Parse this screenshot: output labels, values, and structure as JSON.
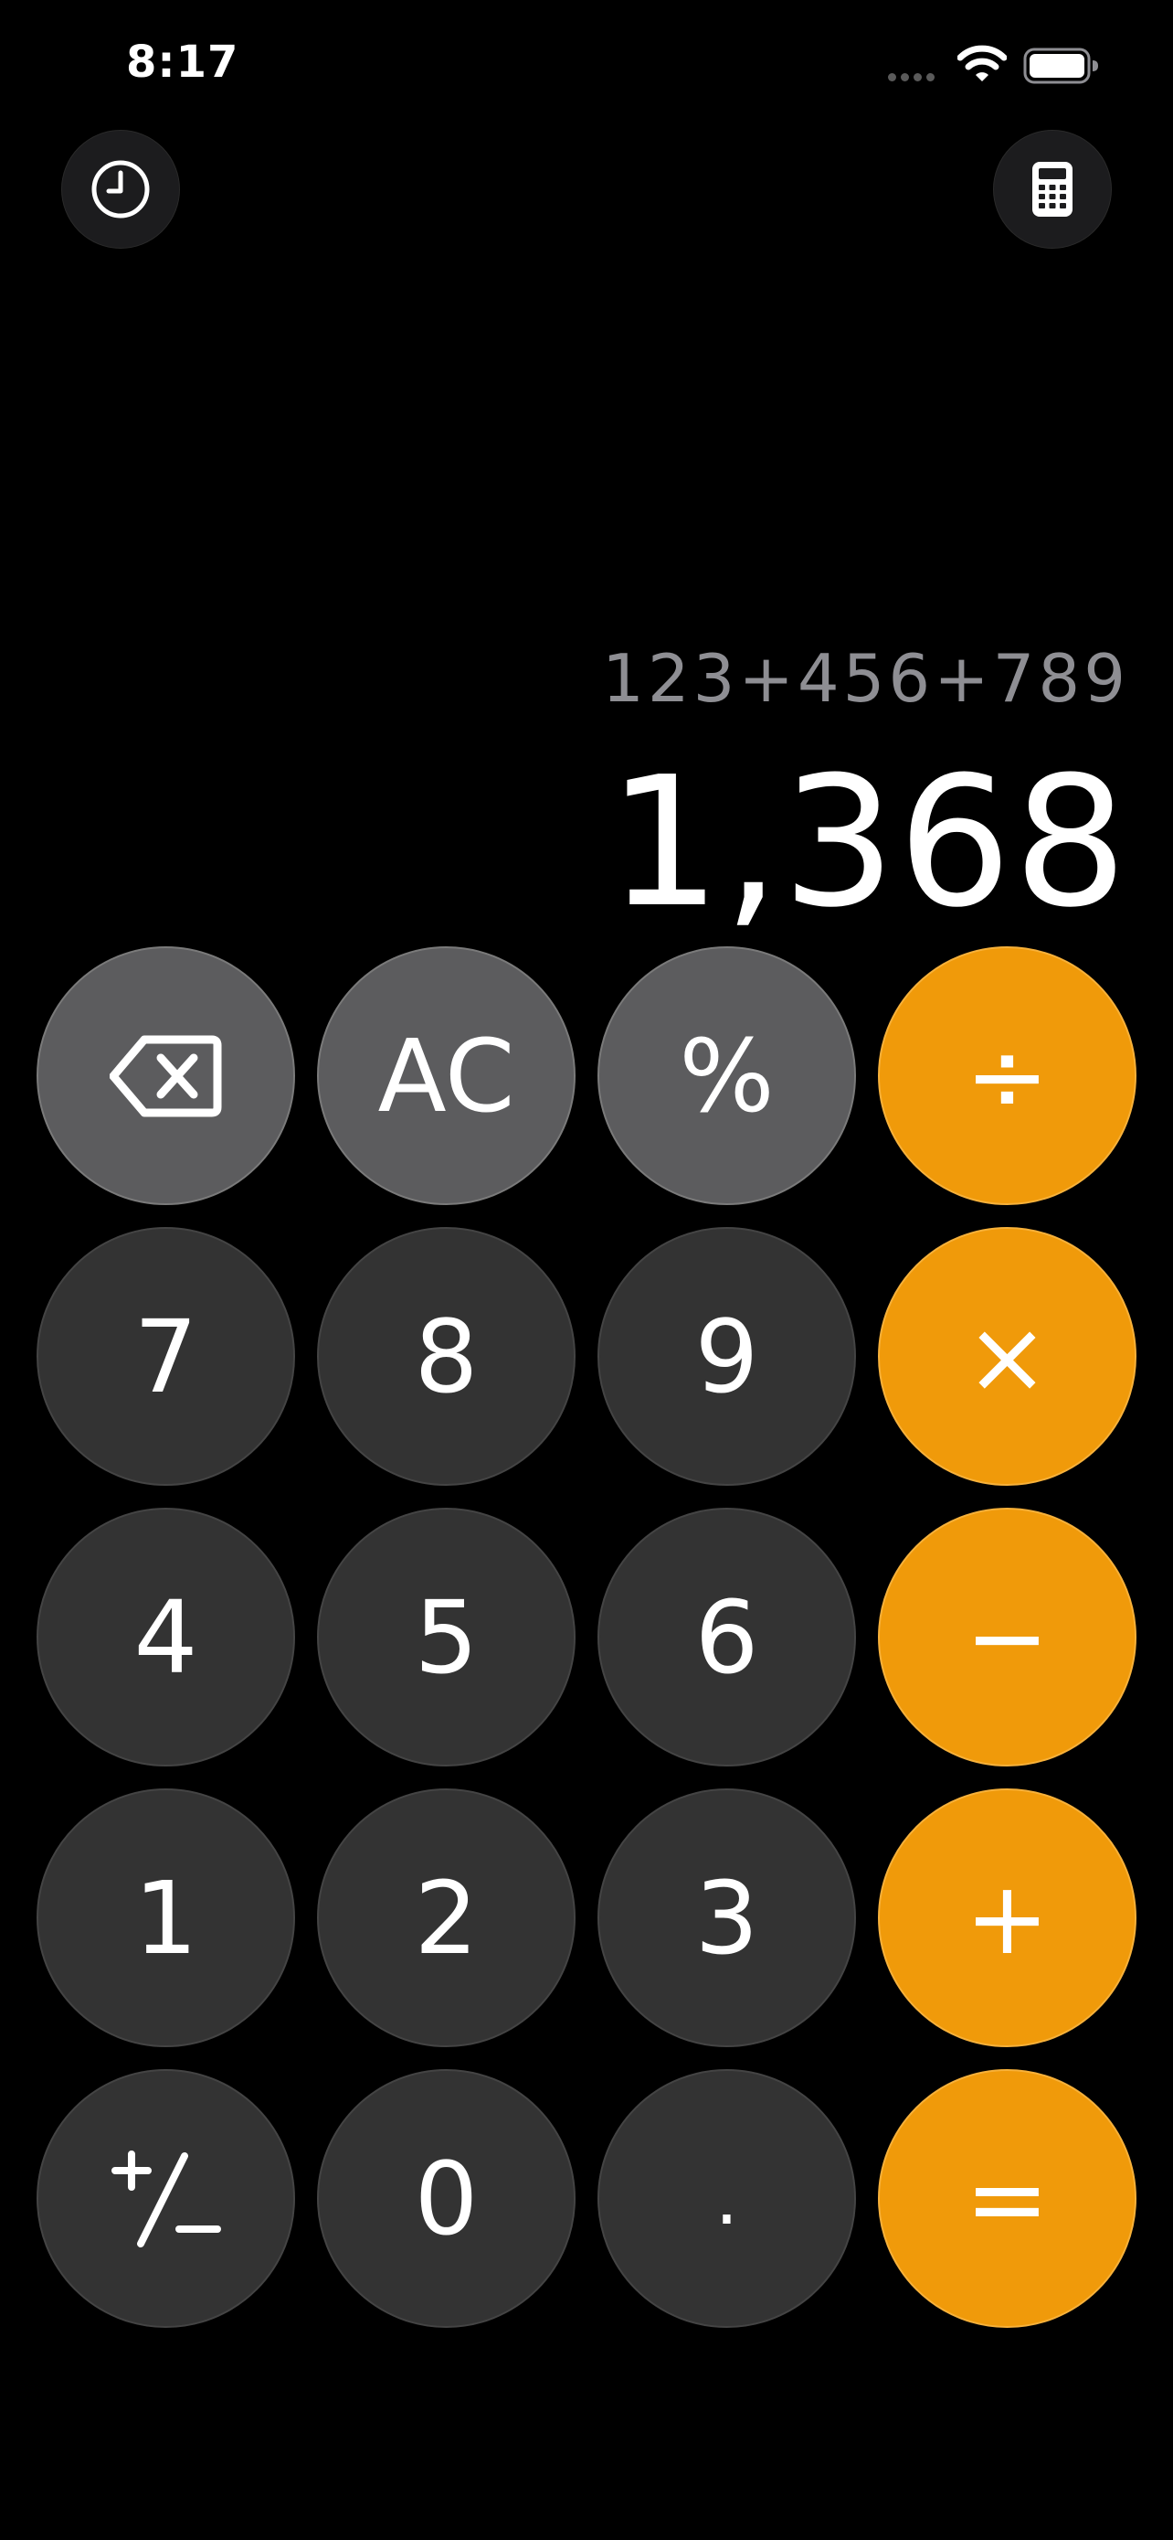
{
  "status_bar": {
    "time": "8:17",
    "icons": [
      "signal-dots-icon",
      "wifi-icon",
      "battery-icon"
    ]
  },
  "top_buttons": {
    "history": "history-clock-icon",
    "mode": "calculator-icon"
  },
  "display": {
    "expression": "123+456+789",
    "result": "1,368"
  },
  "keypad": {
    "row1": [
      "backspace-icon",
      "AC",
      "%",
      "÷"
    ],
    "row2": [
      "7",
      "8",
      "9",
      "×"
    ],
    "row3": [
      "4",
      "5",
      "6",
      "−"
    ],
    "row4": [
      "1",
      "2",
      "3",
      "+"
    ],
    "row5": [
      "plus-minus-icon",
      "0",
      ".",
      "="
    ]
  },
  "colors": {
    "background": "#000000",
    "digit_key": "#333333",
    "function_key": "#5c5c5e",
    "operator_key": "#f09a0a",
    "expression_text": "#8e8e93",
    "result_text": "#ffffff"
  }
}
